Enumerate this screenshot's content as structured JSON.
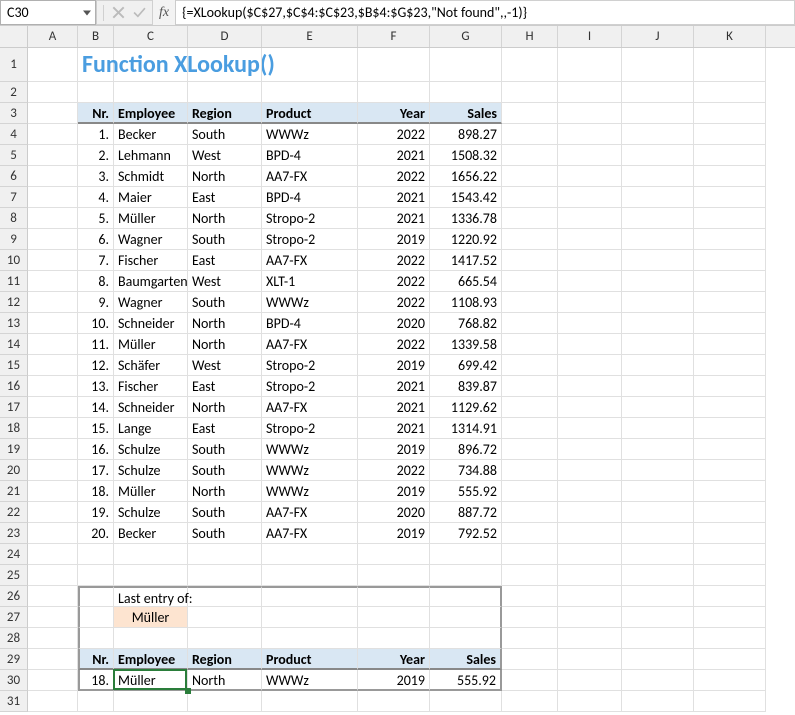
{
  "nameBox": "C30",
  "formula": "{=XLookup($C$27,$C$4:$C$23,$B$4:$G$23,\"Not found\",,-1)}",
  "fxLabel": "fx",
  "title": "Function XLookup()",
  "columns": [
    "A",
    "B",
    "C",
    "D",
    "E",
    "F",
    "G",
    "H",
    "I",
    "J",
    "K"
  ],
  "headers": {
    "nr": "Nr.",
    "employee": "Employee",
    "region": "Region",
    "product": "Product",
    "year": "Year",
    "sales": "Sales"
  },
  "lookup": {
    "label": "Last entry of:",
    "value": "Müller"
  },
  "chart_data": {
    "type": "table",
    "columns": [
      "Nr.",
      "Employee",
      "Region",
      "Product",
      "Year",
      "Sales"
    ],
    "rows": [
      [
        "1.",
        "Becker",
        "South",
        "WWWz",
        "2022",
        "898.27"
      ],
      [
        "2.",
        "Lehmann",
        "West",
        "BPD-4",
        "2021",
        "1508.32"
      ],
      [
        "3.",
        "Schmidt",
        "North",
        "AA7-FX",
        "2022",
        "1656.22"
      ],
      [
        "4.",
        "Maier",
        "East",
        "BPD-4",
        "2021",
        "1543.42"
      ],
      [
        "5.",
        "Müller",
        "North",
        "Stropo-2",
        "2021",
        "1336.78"
      ],
      [
        "6.",
        "Wagner",
        "South",
        "Stropo-2",
        "2019",
        "1220.92"
      ],
      [
        "7.",
        "Fischer",
        "East",
        "AA7-FX",
        "2022",
        "1417.52"
      ],
      [
        "8.",
        "Baumgarten",
        "West",
        "XLT-1",
        "2022",
        "665.54"
      ],
      [
        "9.",
        "Wagner",
        "South",
        "WWWz",
        "2022",
        "1108.93"
      ],
      [
        "10.",
        "Schneider",
        "North",
        "BPD-4",
        "2020",
        "768.82"
      ],
      [
        "11.",
        "Müller",
        "North",
        "AA7-FX",
        "2022",
        "1339.58"
      ],
      [
        "12.",
        "Schäfer",
        "West",
        "Stropo-2",
        "2019",
        "699.42"
      ],
      [
        "13.",
        "Fischer",
        "East",
        "Stropo-2",
        "2021",
        "839.87"
      ],
      [
        "14.",
        "Schneider",
        "North",
        "AA7-FX",
        "2021",
        "1129.62"
      ],
      [
        "15.",
        "Lange",
        "East",
        "Stropo-2",
        "2021",
        "1314.91"
      ],
      [
        "16.",
        "Schulze",
        "South",
        "WWWz",
        "2019",
        "896.72"
      ],
      [
        "17.",
        "Schulze",
        "South",
        "WWWz",
        "2022",
        "734.88"
      ],
      [
        "18.",
        "Müller",
        "North",
        "WWWz",
        "2019",
        "555.92"
      ],
      [
        "19.",
        "Schulze",
        "South",
        "AA7-FX",
        "2020",
        "887.72"
      ],
      [
        "20.",
        "Becker",
        "South",
        "AA7-FX",
        "2019",
        "792.52"
      ]
    ],
    "result_row": [
      "18.",
      "Müller",
      "North",
      "WWWz",
      "2019",
      "555.92"
    ]
  }
}
